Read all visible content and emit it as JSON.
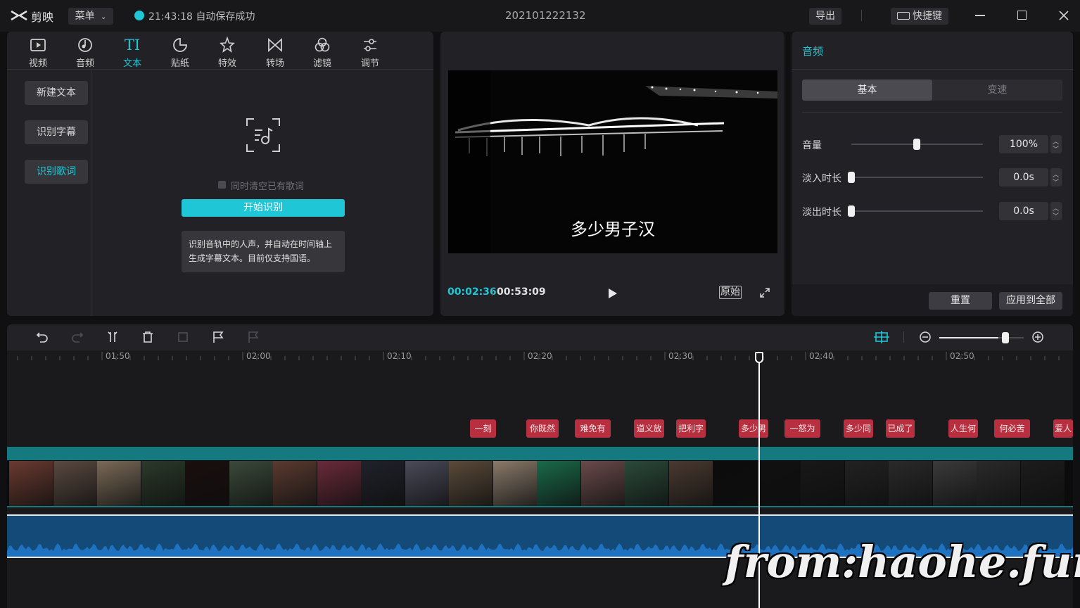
{
  "app": {
    "name": "剪映",
    "menu_label": "菜单",
    "save_status": "21:43:18 自动保存成功",
    "project_name": "202101222132",
    "export_label": "导出",
    "shortcut_label": "快捷键"
  },
  "toolbar": {
    "tabs": [
      {
        "label": "视频",
        "icon": "video-icon"
      },
      {
        "label": "音频",
        "icon": "audio-icon"
      },
      {
        "label": "文本",
        "icon": "text-icon"
      },
      {
        "label": "贴纸",
        "icon": "sticker-icon"
      },
      {
        "label": "特效",
        "icon": "effects-icon"
      },
      {
        "label": "转场",
        "icon": "transition-icon"
      },
      {
        "label": "滤镜",
        "icon": "filter-icon"
      },
      {
        "label": "调节",
        "icon": "adjust-icon"
      }
    ],
    "active": "文本"
  },
  "text_panel": {
    "side_items": [
      "新建文本",
      "识别字幕",
      "识别歌词"
    ],
    "active_side": "识别歌词",
    "checkbox_label": "同时清空已有歌词",
    "start_button": "开始识别",
    "description": "识别音轨中的人声，并自动在时间轴上生成字幕文本。目前仅支持国语。"
  },
  "player": {
    "subtitle": "多少男子汉",
    "current_time": "00:02:36",
    "total_time": "00:53:09",
    "ratio_label": "原始"
  },
  "audio_panel": {
    "title": "音频",
    "tabs": [
      "基本",
      "变速"
    ],
    "active_tab": "基本",
    "rows": [
      {
        "label": "音量",
        "value": "100%",
        "level": 0.5
      },
      {
        "label": "淡入时长",
        "value": "0.0s",
        "level": 0
      },
      {
        "label": "淡出时长",
        "value": "0.0s",
        "level": 0
      }
    ],
    "reset_label": "重置",
    "apply_all_label": "应用到全部"
  },
  "timeline": {
    "ticks": [
      "01:50",
      "02:00",
      "02:10",
      "02:20",
      "02:30",
      "02:40",
      "02:50"
    ],
    "zoom_level": 0.7,
    "lyric_clips": [
      "一刻",
      "你既然",
      "难免有",
      "道义放",
      "把利字",
      "多少男",
      "一怒为",
      "多少同",
      "已成了",
      "人生何",
      "何必苦",
      "爱人"
    ]
  },
  "watermark": "from:haohe.fun",
  "colors": {
    "accent": "#1fc6d6",
    "lyric": "#b83040",
    "audio": "#134a78",
    "video_track": "#147a80"
  }
}
